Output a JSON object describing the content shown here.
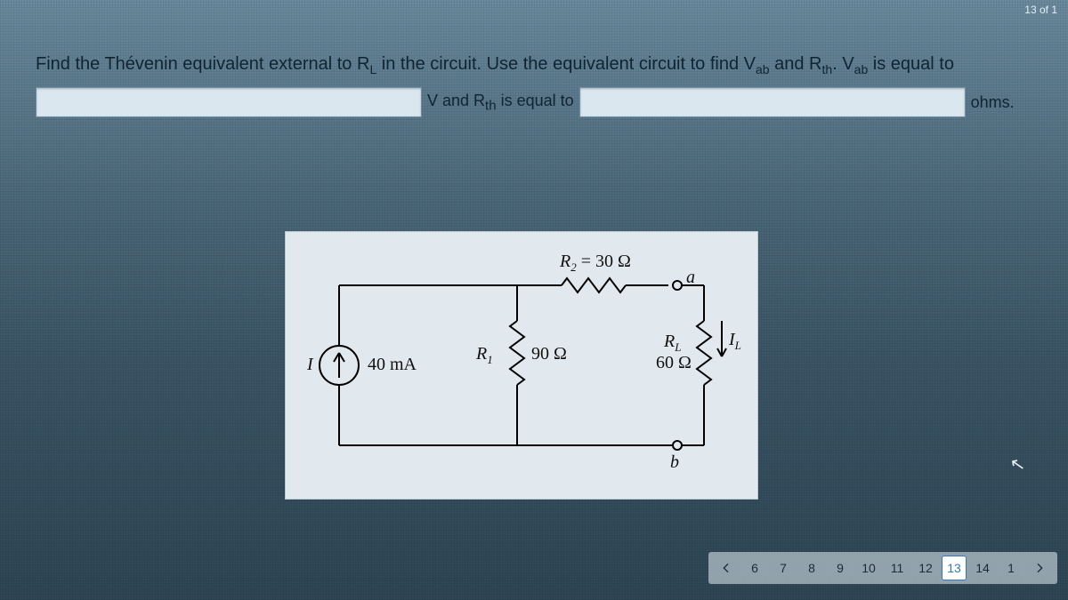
{
  "page_counter": "13 of 1",
  "question": {
    "prefix": "Find the Thévenin equivalent external to ",
    "rl": "R",
    "rl_sub": "L",
    "mid1": " in the circuit. Use the equivalent circuit to find V",
    "vab_sub1": "ab",
    "mid2": " and R",
    "rth_sub1": "th",
    "mid3": ". V",
    "vab_sub2": "ab",
    "mid4": " is equal to"
  },
  "answers": {
    "between1_pre": "V and R",
    "between1_sub": "th",
    "between1_post": " is equal to",
    "unit2": "ohms.",
    "value1": "",
    "value2": ""
  },
  "circuit": {
    "I_label": "I",
    "I_value": "40 mA",
    "R1_label": "R",
    "R1_sub": "1",
    "R1_value": "90 Ω",
    "R2_label": "R",
    "R2_sub": "2",
    "R2_equals": " = 30 Ω",
    "RL_label": "R",
    "RL_sub": "L",
    "RL_value": "60 Ω",
    "IL_label": "I",
    "IL_sub": "L",
    "node_a": "a",
    "node_b": "b"
  },
  "pager": {
    "items": [
      "6",
      "7",
      "8",
      "9",
      "10",
      "11",
      "12",
      "13",
      "14",
      "1"
    ],
    "active": "13"
  }
}
